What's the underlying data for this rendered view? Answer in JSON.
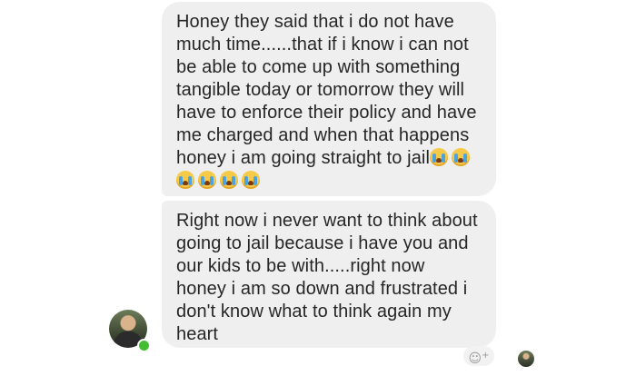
{
  "messages": [
    {
      "text": "Honey they said that i do not have\nmuch time......that if i know i can not\nbe able to come up with something\ntangible today or tomorrow they will\nhave to enforce their policy and have\nme charged and when that happens\nhoney i am going straight to jail",
      "emoji_count": 6,
      "emoji_name": "loudly-crying-face"
    },
    {
      "text": "Right now i never want to think about\ngoing to jail because i have you and\nour kids to be with.....right now\nhoney i am so down and frustrated i\ndon't know what to think again my\nheart"
    }
  ],
  "icons": {
    "react": "smiley-add-reaction-icon",
    "react_plus": "+"
  },
  "colors": {
    "bubble_background": "#efefef",
    "text": "#262626",
    "online_indicator": "#44bd32"
  }
}
